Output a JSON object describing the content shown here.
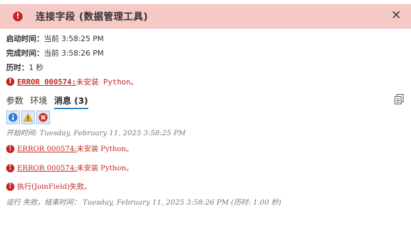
{
  "header": {
    "title": "连接字段 (数据管理工具)",
    "close_glyph": "✕",
    "bg_color": "#f5c9c6",
    "error_color": "#c4271f"
  },
  "meta": {
    "start_label": "启动时间：",
    "start_value": "当前 3:58:25 PM",
    "end_label": "完成时间：",
    "end_value": "当前 3:58:26 PM",
    "duration_label": "历时：",
    "duration_value": "1 秒"
  },
  "error_summary": {
    "code": "ERROR 000574:",
    "text": " 未安装 Python。"
  },
  "tabs": [
    {
      "label": "参数"
    },
    {
      "label": "环境"
    },
    {
      "label": "消息 (3)",
      "active": true
    }
  ],
  "filters": [
    {
      "icon": "info-icon"
    },
    {
      "icon": "warning-icon"
    },
    {
      "icon": "error-icon"
    }
  ],
  "messages": {
    "start": "开始时间: Tuesday, February 11, 2025 3:58:25 PM",
    "err1_code": "ERROR 000574:",
    "err1_text": " 未安装 Python。",
    "err2_code": "ERROR 000574:",
    "err2_text": " 未安装 Python。",
    "err3_text": "执行(JoinField)失败。",
    "end": "运行 失败，结束时间： Tuesday, February 11, 2025 3:58:26 PM (历时: 1.00 秒)"
  }
}
